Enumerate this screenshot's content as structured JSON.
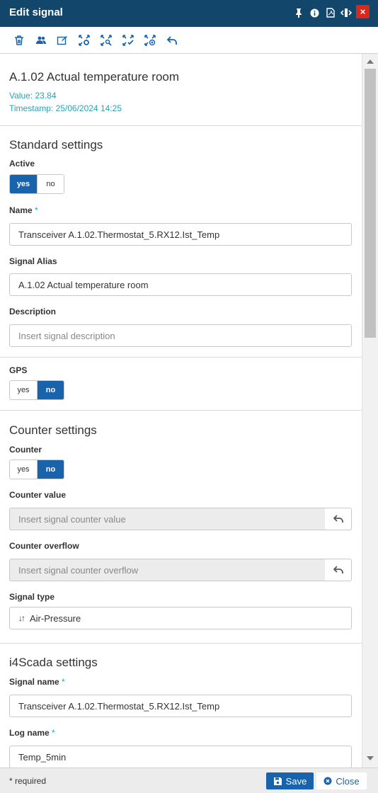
{
  "window": {
    "title": "Edit signal",
    "close_glyph": "×",
    "icons": [
      "pin-icon",
      "info-icon",
      "pdf-icon",
      "resize-icon",
      "close-icon"
    ]
  },
  "toolbar": {
    "tools": [
      "delete-icon",
      "users-icon",
      "edit-icon",
      "settings-nodes-icon",
      "search-nodes-icon",
      "check-nodes-icon",
      "target-nodes-icon",
      "undo-icon"
    ]
  },
  "signal_header": {
    "title": "A.1.02 Actual temperature room",
    "value": "Value: 23.84",
    "timestamp": "Timestamp: 25/06/2024 14:25"
  },
  "standard": {
    "title": "Standard settings",
    "active_label": "Active",
    "active_yes": "yes",
    "active_no": "no",
    "name_label": "Name",
    "required_mark": "*",
    "name_value": "Transceiver A.1.02.Thermostat_5.RX12.Ist_Temp",
    "alias_label": "Signal Alias",
    "alias_value": "A.1.02 Actual temperature room",
    "description_label": "Description",
    "description_placeholder": "Insert signal description",
    "gps_label": "GPS",
    "gps_yes": "yes",
    "gps_no": "no"
  },
  "counter": {
    "title": "Counter settings",
    "counter_label": "Counter",
    "counter_yes": "yes",
    "counter_no": "no",
    "value_label": "Counter value",
    "value_placeholder": "Insert signal counter value",
    "overflow_label": "Counter overflow",
    "overflow_placeholder": "Insert signal counter overflow",
    "type_label": "Signal type",
    "type_icon": "↓↑",
    "type_value": "Air-Pressure"
  },
  "i4scada": {
    "title": "i4Scada settings",
    "signal_name_label": "Signal name",
    "signal_name_value": "Transceiver A.1.02.Thermostat_5.RX12.Ist_Temp",
    "log_name_label": "Log name",
    "log_name_value": "Temp_5min"
  },
  "footer": {
    "required_note": "* required",
    "save_label": "Save",
    "close_label": "Close"
  },
  "colors": {
    "titlebar": "#12466b",
    "accent": "#1863ab",
    "meta": "#26a3b8",
    "close": "#d9281c"
  }
}
